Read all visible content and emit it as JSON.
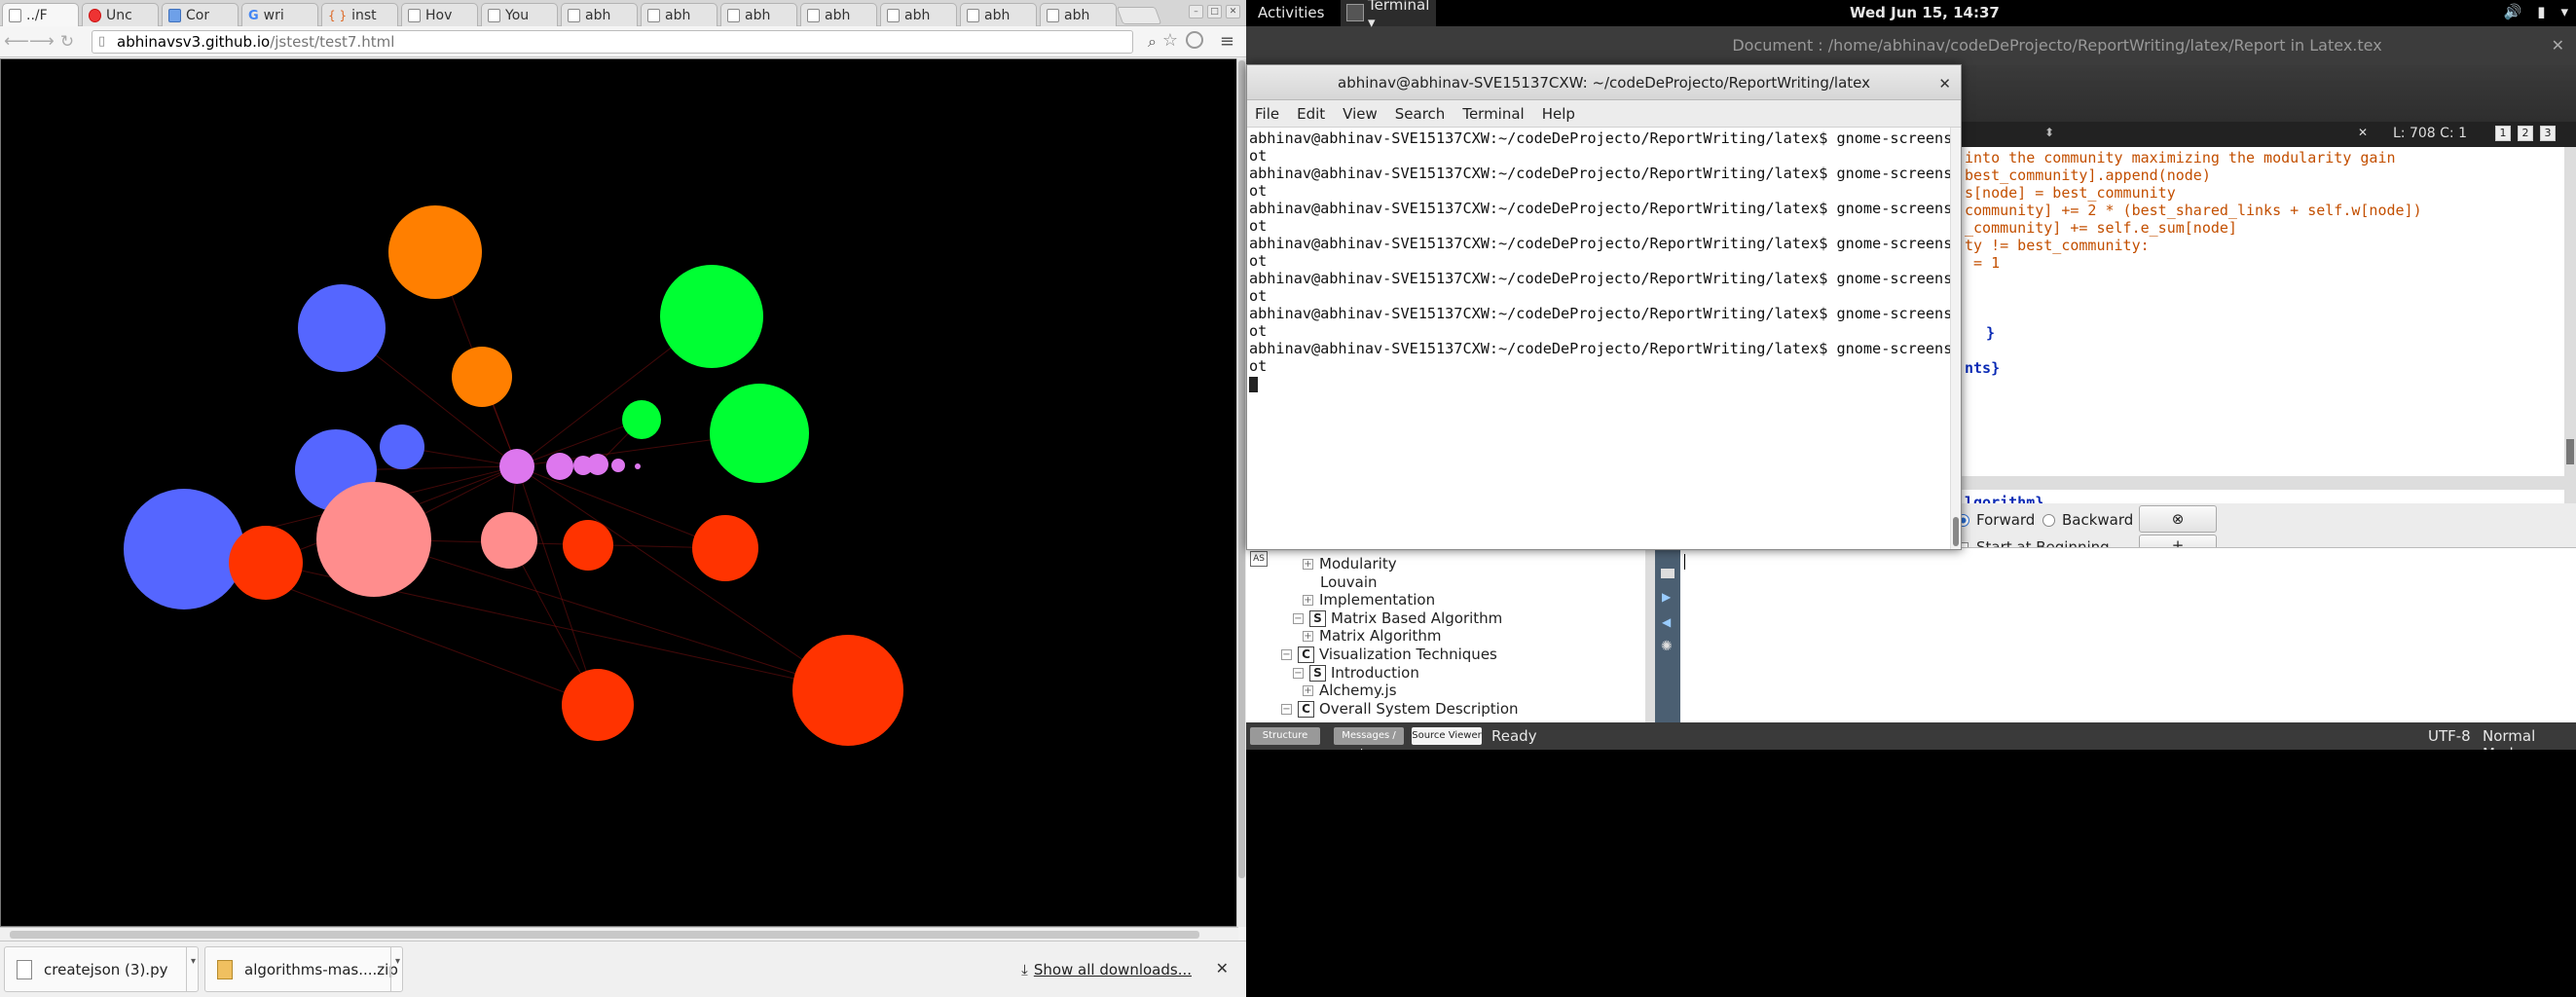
{
  "browser": {
    "tabs": [
      {
        "label": "../F",
        "icon": "page-icon"
      },
      {
        "label": "Unc",
        "icon": "red-circle-icon"
      },
      {
        "label": "Cor",
        "icon": "logo-icon"
      },
      {
        "label": "wri",
        "icon": "google-icon"
      },
      {
        "label": "inst",
        "icon": "braces-icon"
      },
      {
        "label": "Hov",
        "icon": "page-icon"
      },
      {
        "label": "You",
        "icon": "page-icon"
      },
      {
        "label": "abh",
        "icon": "page-icon"
      },
      {
        "label": "abh",
        "icon": "page-icon"
      },
      {
        "label": "abh",
        "icon": "page-icon"
      },
      {
        "label": "abh",
        "icon": "page-icon"
      },
      {
        "label": "abh",
        "icon": "page-icon"
      },
      {
        "label": "abh",
        "icon": "page-icon"
      },
      {
        "label": "abh",
        "icon": "page-icon"
      }
    ],
    "url_host": "abhinavsv3.github.io",
    "url_path": "/jstest/test7.html",
    "downloads": [
      {
        "name": "createjson (3).py"
      },
      {
        "name": "algorithms-mas....zip"
      }
    ],
    "show_all": "Show all downloads..."
  },
  "graph": {
    "colors": {
      "orange": "#ff7f00",
      "blue": "#5566ff",
      "green": "#00ff33",
      "violet": "#dd77ee",
      "pink": "#ff8d8d",
      "red": "#ff3300",
      "edge": "#7a1010"
    }
  },
  "desktop": {
    "activities": "Activities",
    "app_name": "Terminal ▾",
    "clock": "Wed Jun 15, 14:37"
  },
  "texmaker": {
    "title": "Document : /home/abhinav/codeDeProjecto/ReportWriting/latex/Report in Latex.tex",
    "cursor_pos": "L: 708 C: 1",
    "code_lines": [
      "into the community maximizing the modularity gain",
      "best_community].append(node)",
      "s[node] = best_community",
      "community] += 2 * (best_shared_links + self.w[node])",
      "_community] += self.e_sum[node]",
      "ty != best_community:",
      " = 1",
      "}",
      "nts}",
      "lgorithm}"
    ],
    "find": {
      "forward": "Forward",
      "backward": "Backward",
      "start_at_beginning": "Start at Beginning",
      "add": "+"
    },
    "tree": [
      {
        "label": "Modularity",
        "level": 2,
        "toggle": "+"
      },
      {
        "label": "Louvain",
        "level": 2,
        "toggle": ""
      },
      {
        "label": "Implementation",
        "level": 2,
        "toggle": "+"
      },
      {
        "label": "Matrix Based Algorithm",
        "level": 1,
        "toggle": "−",
        "badge": "S"
      },
      {
        "label": "Matrix Algorithm",
        "level": 2,
        "toggle": "+"
      },
      {
        "label": "Visualization Techniques",
        "level": 0,
        "toggle": "−",
        "badge": "C"
      },
      {
        "label": "Introduction",
        "level": 1,
        "toggle": "−",
        "badge": "S"
      },
      {
        "label": "Alchemy.js",
        "level": 2,
        "toggle": "+"
      },
      {
        "label": "Overall System Description",
        "level": 0,
        "toggle": "−",
        "badge": "C"
      }
    ],
    "status": {
      "structure": "Structure",
      "messages": "Messages / Log",
      "source_viewer": "Source Viewer",
      "ready": "Ready",
      "encoding": "UTF-8",
      "mode": "Normal Mode"
    }
  },
  "terminal": {
    "title": "abhinav@abhinav-SVE15137CXW: ~/codeDeProjecto/ReportWriting/latex",
    "menu": [
      "File",
      "Edit",
      "View",
      "Search",
      "Terminal",
      "Help"
    ],
    "lines": [
      "abhinav@abhinav-SVE15137CXW:~/codeDeProjecto/ReportWriting/latex$ gnome-screensh",
      "ot",
      "abhinav@abhinav-SVE15137CXW:~/codeDeProjecto/ReportWriting/latex$ gnome-screensh",
      "ot",
      "abhinav@abhinav-SVE15137CXW:~/codeDeProjecto/ReportWriting/latex$ gnome-screensh",
      "ot",
      "abhinav@abhinav-SVE15137CXW:~/codeDeProjecto/ReportWriting/latex$ gnome-screensh",
      "ot",
      "abhinav@abhinav-SVE15137CXW:~/codeDeProjecto/ReportWriting/latex$ gnome-screensh",
      "ot",
      "abhinav@abhinav-SVE15137CXW:~/codeDeProjecto/ReportWriting/latex$ gnome-screensh",
      "ot",
      "abhinav@abhinav-SVE15137CXW:~/codeDeProjecto/ReportWriting/latex$ gnome-screensh",
      "ot"
    ]
  }
}
